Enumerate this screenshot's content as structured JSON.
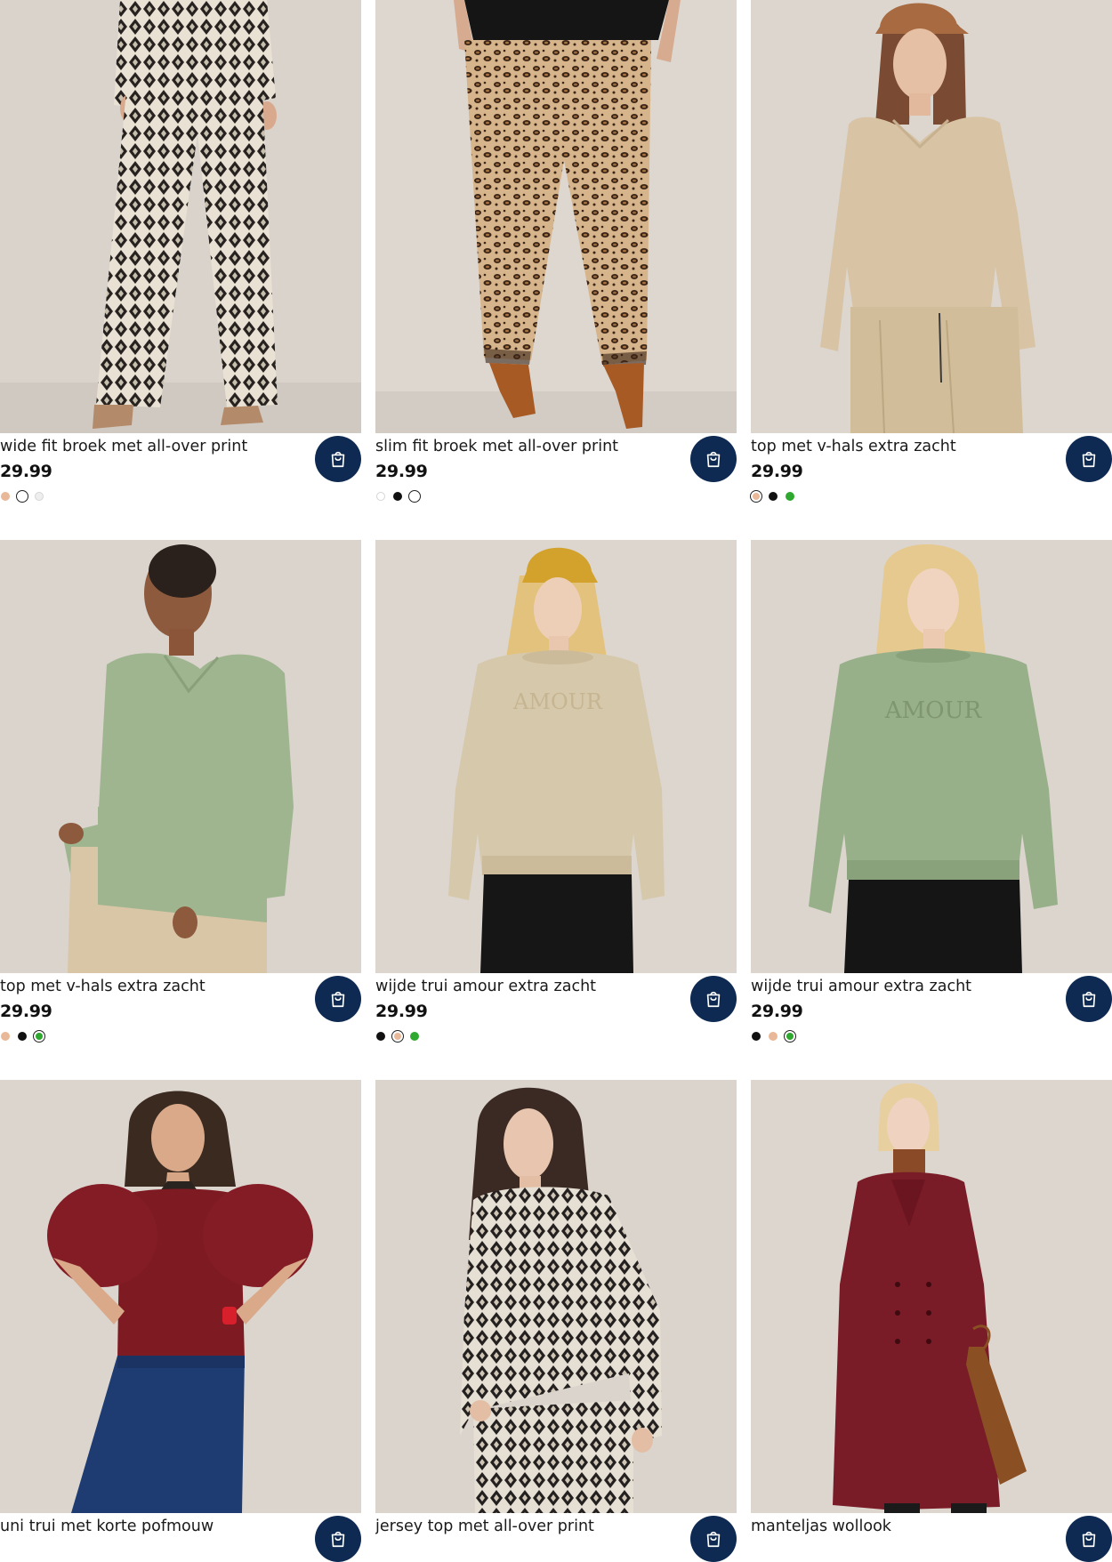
{
  "products": [
    {
      "title": "wide fit broek met all-over print",
      "price": "29.99",
      "image": "woman in black and cream geometric print wide trousers",
      "swatches": [
        {
          "color": "#e8b898",
          "selected": false
        },
        {
          "color": "#ffffff",
          "selected": true
        },
        {
          "color": "#eeeeee",
          "selected": false
        }
      ]
    },
    {
      "title": "slim fit broek met all-over print",
      "price": "29.99",
      "image": "woman in leopard print slim trousers and brown fringed heels",
      "swatches": [
        {
          "color": "#ffffff",
          "selected": false
        },
        {
          "color": "#111111",
          "selected": false
        },
        {
          "color": "#ffffff",
          "selected": true
        }
      ]
    },
    {
      "title": "top met v-hals extra zacht",
      "price": "29.99",
      "image": "woman in beige v-neck top with cap",
      "swatches": [
        {
          "color": "#e8b898",
          "selected": true
        },
        {
          "color": "#111111",
          "selected": false
        },
        {
          "color": "#2ea82e",
          "selected": false
        }
      ]
    },
    {
      "title": "top met v-hals extra zacht",
      "price": "29.99",
      "image": "woman in sage green v-neck top",
      "swatches": [
        {
          "color": "#e8b898",
          "selected": false
        },
        {
          "color": "#111111",
          "selected": false
        },
        {
          "color": "#2ea82e",
          "selected": true
        }
      ]
    },
    {
      "title": "wijde trui amour extra zacht",
      "price": "29.99",
      "image": "woman in beige amour sweater with yellow cap",
      "swatches": [
        {
          "color": "#111111",
          "selected": false
        },
        {
          "color": "#e8b898",
          "selected": true
        },
        {
          "color": "#2ea82e",
          "selected": false
        }
      ]
    },
    {
      "title": "wijde trui amour extra zacht",
      "price": "29.99",
      "image": "woman in green amour sweater",
      "swatches": [
        {
          "color": "#111111",
          "selected": false
        },
        {
          "color": "#e8b898",
          "selected": false
        },
        {
          "color": "#2ea82e",
          "selected": true
        }
      ]
    },
    {
      "title": "uni trui met korte pofmouw",
      "price": "",
      "image": "woman in burgundy knit sweater with puff sleeves and jeans",
      "swatches": []
    },
    {
      "title": "jersey top met all-over print",
      "price": "",
      "image": "woman in black and cream geometric print jersey top",
      "swatches": []
    },
    {
      "title": "manteljas wollook",
      "price": "",
      "image": "woman in long burgundy double-breasted wool coat",
      "swatches": []
    }
  ],
  "colors": {
    "cart_button": "#0e2a52",
    "background": "#ffffff"
  },
  "icons": {
    "cart": "shopping-bag-icon"
  }
}
